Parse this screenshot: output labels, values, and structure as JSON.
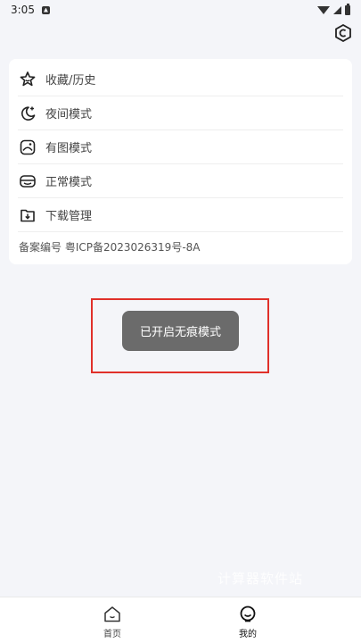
{
  "status_bar": {
    "time": "3:05",
    "icons": [
      "notification-icon",
      "wifi-icon",
      "signal-icon",
      "battery-icon"
    ]
  },
  "header": {
    "action_icon": "hexagon-c-icon"
  },
  "menu": {
    "items": [
      {
        "label": "收藏/历史",
        "icon": "star-icon"
      },
      {
        "label": "夜间模式",
        "icon": "moon-icon"
      },
      {
        "label": "有图模式",
        "icon": "image-mode-icon"
      },
      {
        "label": "正常模式",
        "icon": "mask-icon"
      },
      {
        "label": "下载管理",
        "icon": "download-icon"
      }
    ],
    "record": "备案编号 粤ICP备2023026319号-8A"
  },
  "toast": {
    "text": "已开启无痕模式"
  },
  "watermark": "计算器软件站",
  "bottom_nav": {
    "items": [
      {
        "label": "首页",
        "icon": "home-icon",
        "active": false
      },
      {
        "label": "我的",
        "icon": "profile-icon",
        "active": true
      }
    ]
  },
  "colors": {
    "background": "#f4f5f9",
    "card": "#ffffff",
    "toast": "#6b6b6b",
    "highlight": "#e0302a"
  }
}
